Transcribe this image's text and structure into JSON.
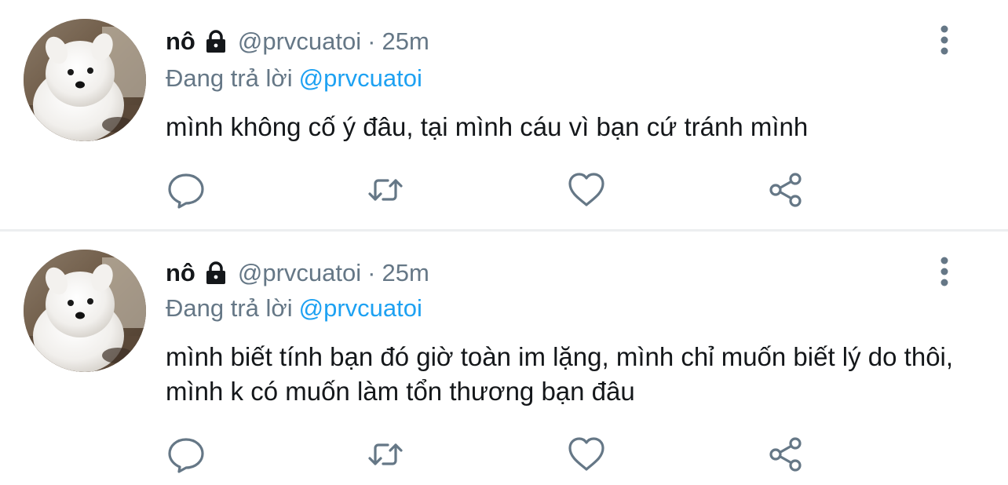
{
  "colors": {
    "text_primary": "#14171a",
    "text_secondary": "#657786",
    "link": "#1da1f2",
    "divider": "#eceef0"
  },
  "icons": {
    "lock": "lock-icon",
    "more": "more-vertical-icon",
    "reply": "reply-icon",
    "retweet": "retweet-icon",
    "like": "heart-icon",
    "share": "share-icon"
  },
  "tweets": [
    {
      "display_name": "nô",
      "handle": "@prvcuatoi",
      "separator": "·",
      "time": "25m",
      "replying_prefix": "Đang trả lời",
      "replying_to": "@prvcuatoi",
      "text": "mình không cố ý đâu, tại mình cáu vì bạn cứ tránh mình"
    },
    {
      "display_name": "nô",
      "handle": "@prvcuatoi",
      "separator": "·",
      "time": "25m",
      "replying_prefix": "Đang trả lời",
      "replying_to": "@prvcuatoi",
      "text": "mình biết tính bạn đó giờ toàn im lặng, mình chỉ muốn biết lý do thôi, mình k có muốn làm tổn thương bạn đâu"
    }
  ]
}
